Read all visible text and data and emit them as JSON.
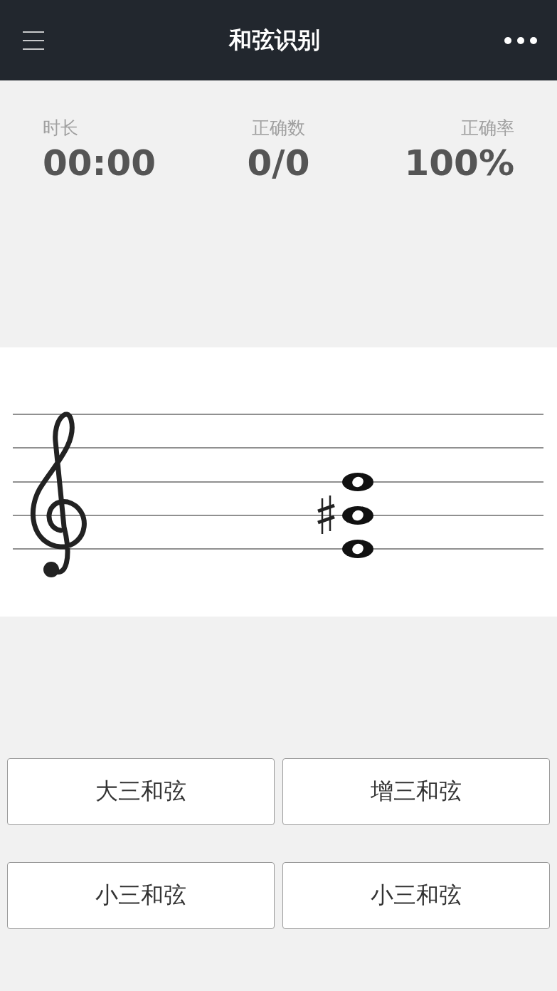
{
  "header": {
    "title": "和弦识别"
  },
  "stats": [
    {
      "label": "时长",
      "value": "00:00"
    },
    {
      "label": "正确数",
      "value": "0/0"
    },
    {
      "label": "正确率",
      "value": "100%"
    }
  ],
  "options": [
    {
      "label": "大三和弦"
    },
    {
      "label": "增三和弦"
    },
    {
      "label": "小三和弦"
    },
    {
      "label": "小三和弦"
    }
  ]
}
